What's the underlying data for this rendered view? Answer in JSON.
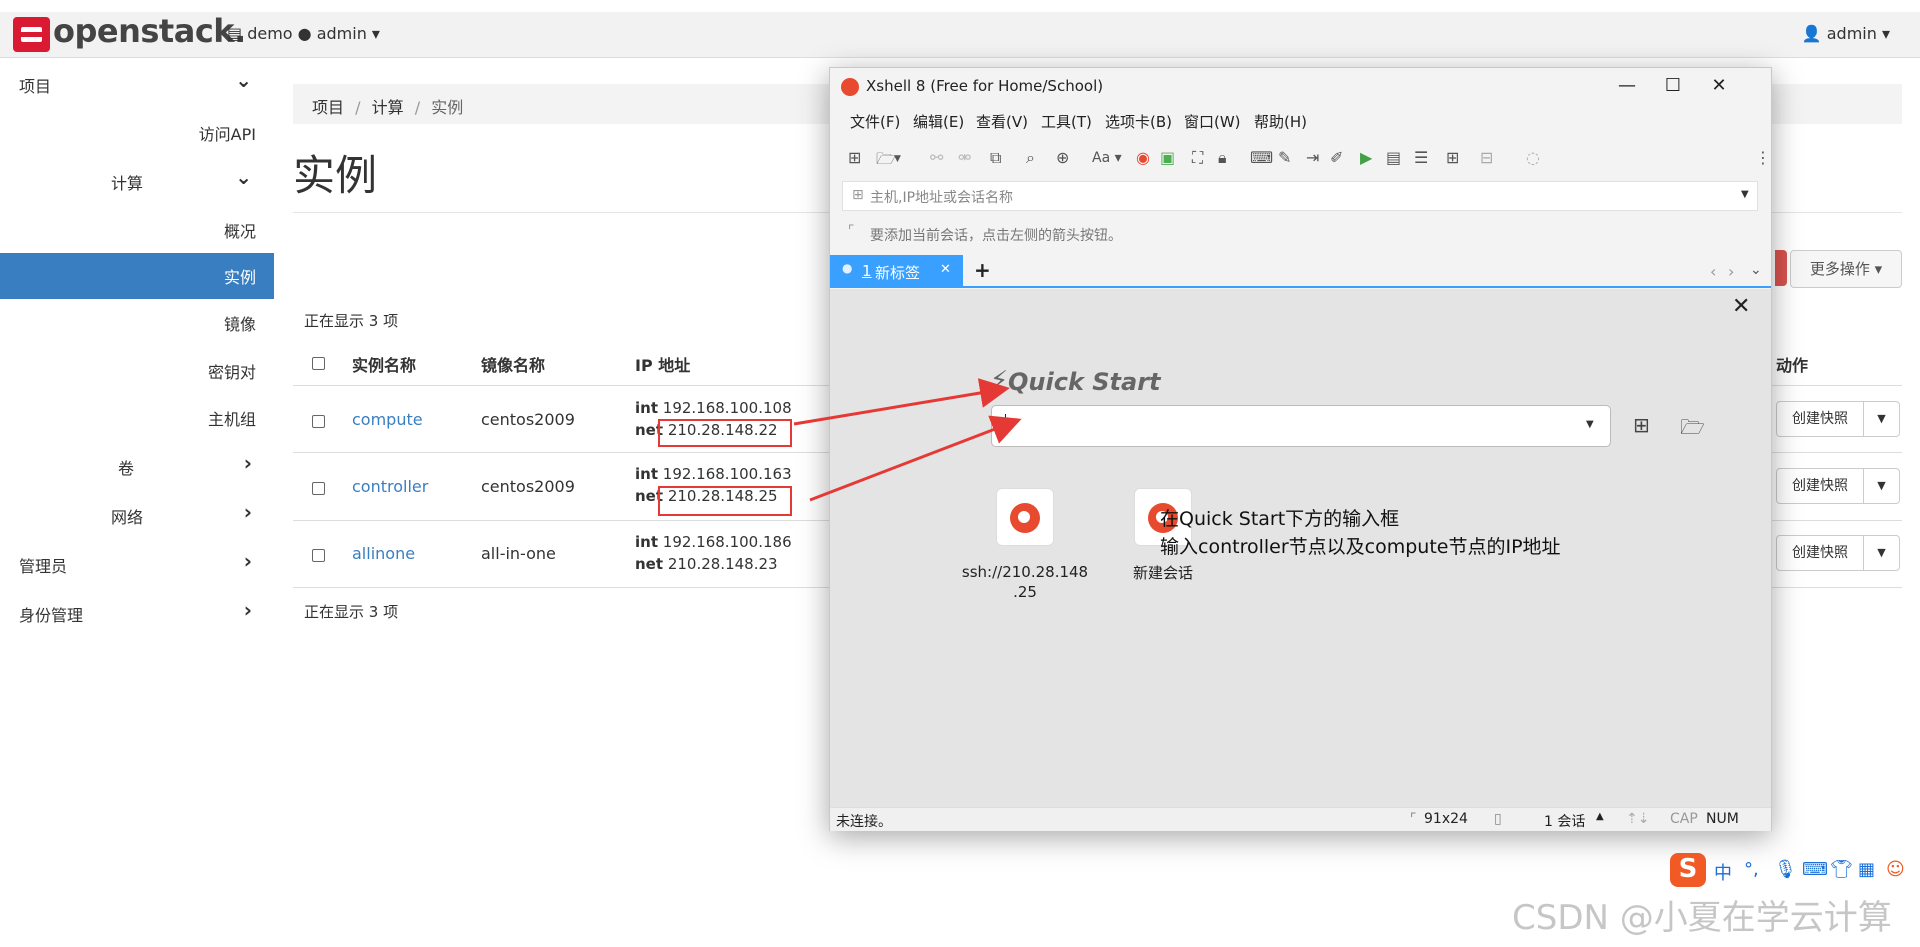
{
  "header": {
    "brand": "openstack.",
    "project_selector": "demo ● admin ▾",
    "user_menu": "admin ▾"
  },
  "sidebar": {
    "items": [
      {
        "label": "项目",
        "chevron": "⌄"
      },
      {
        "label": "访问API"
      },
      {
        "label": "计算",
        "chevron": "⌄"
      },
      {
        "label": "概况"
      },
      {
        "label": "实例"
      },
      {
        "label": "镜像"
      },
      {
        "label": "密钥对"
      },
      {
        "label": "主机组"
      },
      {
        "label": "卷",
        "chevron": "›"
      },
      {
        "label": "网络",
        "chevron": "›"
      },
      {
        "label": "管理员",
        "chevron": "›"
      },
      {
        "label": "身份管理",
        "chevron": "›"
      }
    ]
  },
  "breadcrumb": {
    "items": [
      "项目",
      "计算",
      "实例"
    ],
    "sep": "/"
  },
  "page_title": "实例",
  "more_actions": "更多操作 ▾",
  "count_text": "正在显示 3 项",
  "table": {
    "headers": [
      "实例名称",
      "镜像名称",
      "IP 地址",
      "动作"
    ],
    "rows": [
      {
        "name": "compute",
        "image": "centos2009",
        "int_label": "int",
        "int_ip": "192.168.100.108",
        "net_label": "net",
        "net_ip": "210.28.148.22",
        "action": "创建快照"
      },
      {
        "name": "controller",
        "image": "centos2009",
        "int_label": "int",
        "int_ip": "192.168.100.163",
        "net_label": "net",
        "net_ip": "210.28.148.25",
        "action": "创建快照"
      },
      {
        "name": "allinone",
        "image": "all-in-one",
        "int_label": "int",
        "int_ip": "192.168.100.186",
        "net_label": "net",
        "net_ip": "210.28.148.23",
        "action": "创建快照"
      }
    ]
  },
  "xshell": {
    "title": "Xshell 8 (Free for Home/School)",
    "window_buttons": [
      "—",
      "☐",
      "✕"
    ],
    "menu": [
      "文件(F)",
      "编辑(E)",
      "查看(V)",
      "工具(T)",
      "选项卡(B)",
      "窗口(W)",
      "帮助(H)"
    ],
    "address_placeholder": "主机,IP地址或会话名称",
    "hint": "要添加当前会话，点击左侧的箭头按钮。",
    "tab": {
      "index": "1",
      "label": "新标签",
      "close": "✕"
    },
    "add_tab": "+",
    "quick_start": "Quick Start",
    "close_panel": "✕",
    "sessions": [
      {
        "label": "ssh://210.28.148.25",
        "line1": "ssh://210.28.148",
        "line2": ".25"
      },
      {
        "label": "新建会话"
      }
    ],
    "note": [
      "在Quick Start下方的输入框",
      "输入controller节点以及compute节点的IP地址"
    ],
    "status": {
      "left": "未连接。",
      "size": "91x24",
      "sessions": "1 会话",
      "cap": "CAP",
      "num": "NUM"
    }
  },
  "ime": {
    "logo": "S",
    "lang": "中"
  },
  "watermark": "CSDN @小夏在学云计算",
  "colors": {
    "accent": "#3a7ec2",
    "brand_red": "#da1a32",
    "xshell_tab": "#3aa0ff",
    "annotation_red": "#e53935"
  }
}
